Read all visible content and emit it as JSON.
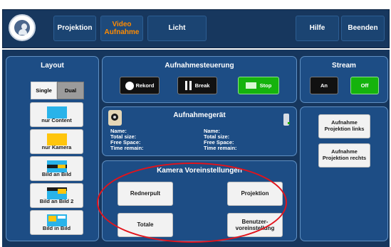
{
  "topbar": {
    "buttons": [
      {
        "label": "Projektion",
        "name": "projektion-tab",
        "active": false
      },
      {
        "label": "Video\nAufnahme",
        "name": "video-aufnahme-tab",
        "active": true
      },
      {
        "label": "Licht",
        "name": "licht-tab",
        "active": false
      },
      {
        "label": "Hilfe",
        "name": "hilfe-button",
        "active": false
      },
      {
        "label": "Beenden",
        "name": "beenden-button",
        "active": false
      }
    ],
    "video_label": "Video\nAufnahme"
  },
  "layout": {
    "title": "Layout",
    "single": "Single",
    "dual": "Dual",
    "buttons": [
      {
        "label": "nur Content",
        "icon": "content-layout-icon"
      },
      {
        "label": "nur Kamera",
        "icon": "kamera-layout-icon"
      },
      {
        "label": "Bild an Bild",
        "icon": "bild-an-bild-icon"
      },
      {
        "label": "Bild an Bild 2",
        "icon": "bild-an-bild-2-icon"
      },
      {
        "label": "Bild in Bild",
        "icon": "bild-in-bild-icon"
      }
    ]
  },
  "recording": {
    "title": "Aufnahmesteuerung",
    "buttons": [
      {
        "label": "Rekord",
        "icon": "record-icon"
      },
      {
        "label": "Break",
        "icon": "pause-icon"
      },
      {
        "label": "Stop",
        "icon": "stop-icon"
      }
    ]
  },
  "stream": {
    "title": "Stream",
    "on": "An",
    "off": "Off"
  },
  "device": {
    "title": "Aufnahmegerät",
    "left_labels": [
      "Name:",
      "Total size:",
      "Free Space:",
      "Time remain:"
    ],
    "right_labels": [
      "Name:",
      "Total size:",
      "Free Space:",
      "Time remain:"
    ]
  },
  "camera": {
    "title": "Kamera Voreinstellungen",
    "buttons": [
      {
        "label": "Rednerpult"
      },
      {
        "label": "Projektion"
      },
      {
        "label": "Totale"
      },
      {
        "label": "Benutzer-\nvoreinstellung"
      }
    ]
  },
  "projection": {
    "buttons": [
      {
        "label": "Aufnahme\nProjektion links"
      },
      {
        "label": "Aufnahme\nProjektion rechts"
      }
    ]
  },
  "colors": {
    "active_tab_text": "#ff8a00",
    "dark_background": "#17375e",
    "panel": "#1d4d85",
    "accent_green": "#15b30d",
    "highlight_oval": "#e3131b"
  }
}
